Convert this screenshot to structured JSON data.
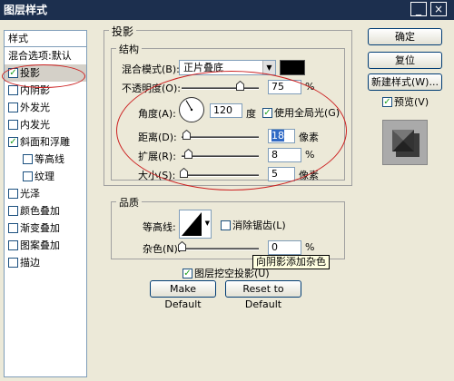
{
  "window": {
    "title": "图层样式",
    "min_label": "_",
    "close_label": "×"
  },
  "styles_list": {
    "header": "样式",
    "items": [
      {
        "label": "混合选项:默认",
        "has_checkbox": false,
        "checked": false,
        "selected": false
      },
      {
        "label": "投影",
        "has_checkbox": true,
        "checked": true,
        "selected": true
      },
      {
        "label": "内阴影",
        "has_checkbox": true,
        "checked": false,
        "selected": false
      },
      {
        "label": "外发光",
        "has_checkbox": true,
        "checked": false,
        "selected": false
      },
      {
        "label": "内发光",
        "has_checkbox": true,
        "checked": false,
        "selected": false
      },
      {
        "label": "斜面和浮雕",
        "has_checkbox": true,
        "checked": true,
        "selected": false
      },
      {
        "label": "等高线",
        "has_checkbox": true,
        "checked": false,
        "selected": false,
        "indent": true
      },
      {
        "label": "纹理",
        "has_checkbox": true,
        "checked": false,
        "selected": false,
        "indent": true
      },
      {
        "label": "光泽",
        "has_checkbox": true,
        "checked": false,
        "selected": false
      },
      {
        "label": "颜色叠加",
        "has_checkbox": true,
        "checked": false,
        "selected": false
      },
      {
        "label": "渐变叠加",
        "has_checkbox": true,
        "checked": false,
        "selected": false
      },
      {
        "label": "图案叠加",
        "has_checkbox": true,
        "checked": false,
        "selected": false
      },
      {
        "label": "描边",
        "has_checkbox": true,
        "checked": false,
        "selected": false
      }
    ]
  },
  "drop_shadow": {
    "section_title": "投影",
    "structure_title": "结构",
    "blend_mode_label": "混合模式(B):",
    "blend_mode_value": "正片叠底",
    "shadow_color": "#000000",
    "opacity_label": "不透明度(O):",
    "opacity_value": "75",
    "opacity_unit": "%",
    "opacity_fraction": 0.75,
    "angle_label": "角度(A):",
    "angle_value": "120",
    "angle_unit": "度",
    "global_light_label": "使用全局光(G)",
    "global_light_checked": true,
    "distance_label": "距离(D):",
    "distance_value": "18",
    "distance_unit": "像素",
    "distance_fraction": 0.06,
    "spread_label": "扩展(R):",
    "spread_value": "8",
    "spread_unit": "%",
    "spread_fraction": 0.08,
    "size_label": "大小(S):",
    "size_value": "5",
    "size_unit": "像素",
    "size_fraction": 0.02
  },
  "quality": {
    "title": "品质",
    "contour_label": "等高线:",
    "antialias_label": "消除锯齿(L)",
    "antialias_checked": false,
    "noise_label": "杂色(N):",
    "noise_value": "0",
    "noise_unit": "%",
    "noise_fraction": 0.0
  },
  "knockout": {
    "label": "图层挖空投影(U)",
    "checked": true
  },
  "tooltip": "向阴影添加杂色",
  "buttons": {
    "make_default": "Make Default",
    "reset_default": "Reset to Default",
    "ok": "确定",
    "cancel": "复位",
    "new_style": "新建样式(W)...",
    "preview_label": "预览(V)",
    "preview_checked": true
  },
  "colors": {
    "title_bg": "#1c2f4e",
    "dialog_bg": "#ece9d8",
    "annotation": "#cc2222",
    "selection": "#316ac5"
  }
}
